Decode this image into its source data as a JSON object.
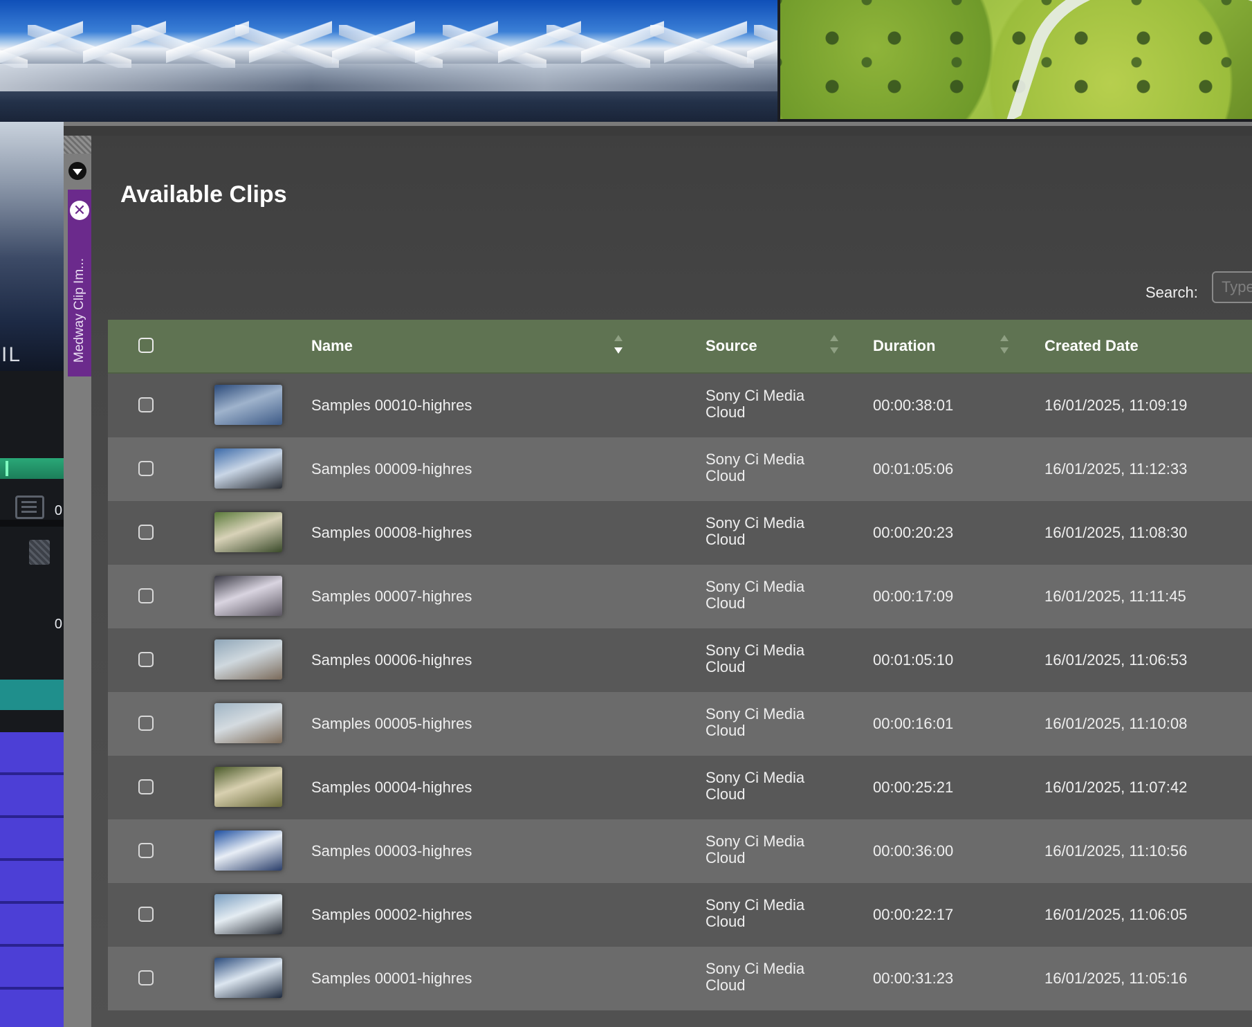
{
  "panel": {
    "side_tab_label": "Medway Clip Im...",
    "title": "Available Clips"
  },
  "search": {
    "label": "Search:",
    "placeholder": "Type"
  },
  "table": {
    "columns": {
      "name": "Name",
      "source": "Source",
      "duration": "Duration",
      "created": "Created Date"
    },
    "rows": [
      {
        "name": "Samples 00010-highres",
        "source": "Sony Ci Media Cloud",
        "duration": "00:00:38:01",
        "created": "16/01/2025, 11:09:19",
        "thumb": [
          "#2b4a7a",
          "#9fb3cc",
          "#3d5a86"
        ]
      },
      {
        "name": "Samples 00009-highres",
        "source": "Sony Ci Media Cloud",
        "duration": "00:01:05:06",
        "created": "16/01/2025, 11:12:33",
        "thumb": [
          "#3c6aa8",
          "#c9d6e6",
          "#2b2f36"
        ]
      },
      {
        "name": "Samples 00008-highres",
        "source": "Sony Ci Media Cloud",
        "duration": "00:00:20:23",
        "created": "16/01/2025, 11:08:30",
        "thumb": [
          "#5a7a3a",
          "#d8d2b8",
          "#3a4a2a"
        ]
      },
      {
        "name": "Samples 00007-highres",
        "source": "Sony Ci Media Cloud",
        "duration": "00:00:17:09",
        "created": "16/01/2025, 11:11:45",
        "thumb": [
          "#3a3a44",
          "#d9d4e0",
          "#5a5560"
        ]
      },
      {
        "name": "Samples 00006-highres",
        "source": "Sony Ci Media Cloud",
        "duration": "00:01:05:10",
        "created": "16/01/2025, 11:06:53",
        "thumb": [
          "#8fa6b8",
          "#cfd8de",
          "#7a6a5a"
        ]
      },
      {
        "name": "Samples 00005-highres",
        "source": "Sony Ci Media Cloud",
        "duration": "00:00:16:01",
        "created": "16/01/2025, 11:10:08",
        "thumb": [
          "#9fb4c4",
          "#d4dbe0",
          "#7d6b58"
        ]
      },
      {
        "name": "Samples 00004-highres",
        "source": "Sony Ci Media Cloud",
        "duration": "00:00:25:21",
        "created": "16/01/2025, 11:07:42",
        "thumb": [
          "#4a5a2a",
          "#d8d0b0",
          "#6a6a3a"
        ]
      },
      {
        "name": "Samples 00003-highres",
        "source": "Sony Ci Media Cloud",
        "duration": "00:00:36:00",
        "created": "16/01/2025, 11:10:56",
        "thumb": [
          "#1e4fa0",
          "#e8eef6",
          "#2a3e6a"
        ]
      },
      {
        "name": "Samples 00002-highres",
        "source": "Sony Ci Media Cloud",
        "duration": "00:00:22:17",
        "created": "16/01/2025, 11:06:05",
        "thumb": [
          "#7a9ec0",
          "#e4ecf2",
          "#2a2f38"
        ]
      },
      {
        "name": "Samples 00001-highres",
        "source": "Sony Ci Media Cloud",
        "duration": "00:00:31:23",
        "created": "16/01/2025, 11:05:16",
        "thumb": [
          "#2a4a7a",
          "#dce6f0",
          "#1e2a3e"
        ]
      }
    ]
  },
  "editor": {
    "timecode_values": [
      "0",
      "0"
    ]
  },
  "icons": {
    "collapse": "chevron-down-circle-icon",
    "close": "close-circle-icon",
    "sort": "sort-arrows-icon",
    "list": "list-icon",
    "grip": "grip-icon"
  },
  "colors": {
    "header_bg": "#5f7352",
    "side_tab": "#6b2a8c",
    "row_odd": "#585858",
    "row_even": "#6b6b6b"
  }
}
